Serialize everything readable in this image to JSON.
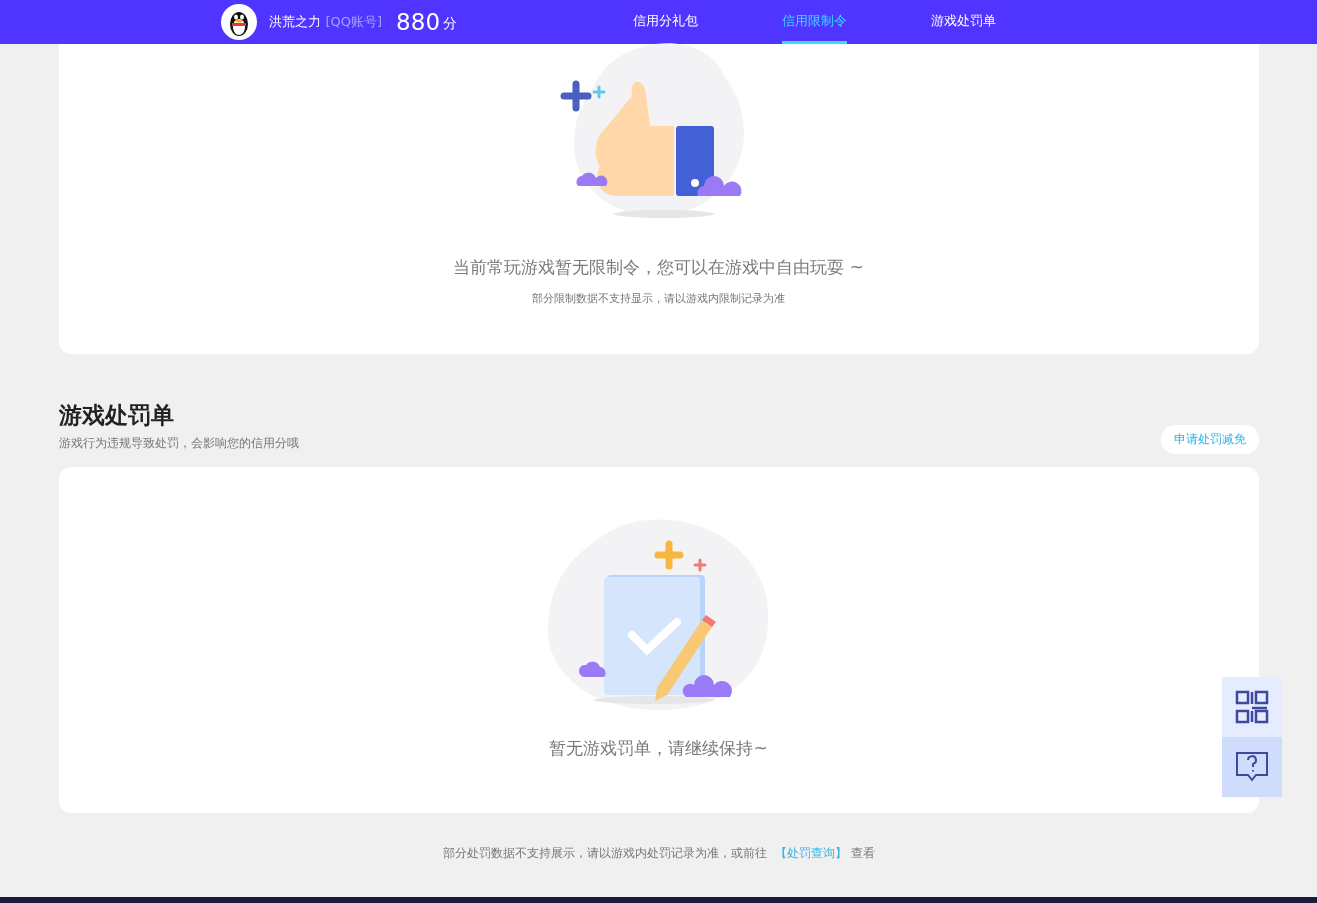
{
  "header": {
    "user_name": "洪荒之力",
    "account_type": "[QQ账号]",
    "score": "880",
    "score_unit": "分",
    "tabs": [
      {
        "label": "信用分礼包",
        "selected": false
      },
      {
        "label": "信用限制令",
        "selected": true
      },
      {
        "label": "游戏处罚单",
        "selected": false
      }
    ]
  },
  "restriction_card": {
    "message": "当前常玩游戏暂无限制令，您可以在游戏中自由玩耍 ~",
    "note": "部分限制数据不支持显示，请以游戏内限制记录为准"
  },
  "penalty_section": {
    "title": "游戏处罚单",
    "subtitle": "游戏行为违规导致处罚，会影响您的信用分哦",
    "appeal_button": "申请处罚减免",
    "message": "暂无游戏罚单，请继续保持~"
  },
  "footer_note": {
    "text_before": "部分处罚数据不支持展示，请以游戏内处罚记录为准，或前往",
    "link": "【处罚查询】",
    "text_after": "查看"
  }
}
